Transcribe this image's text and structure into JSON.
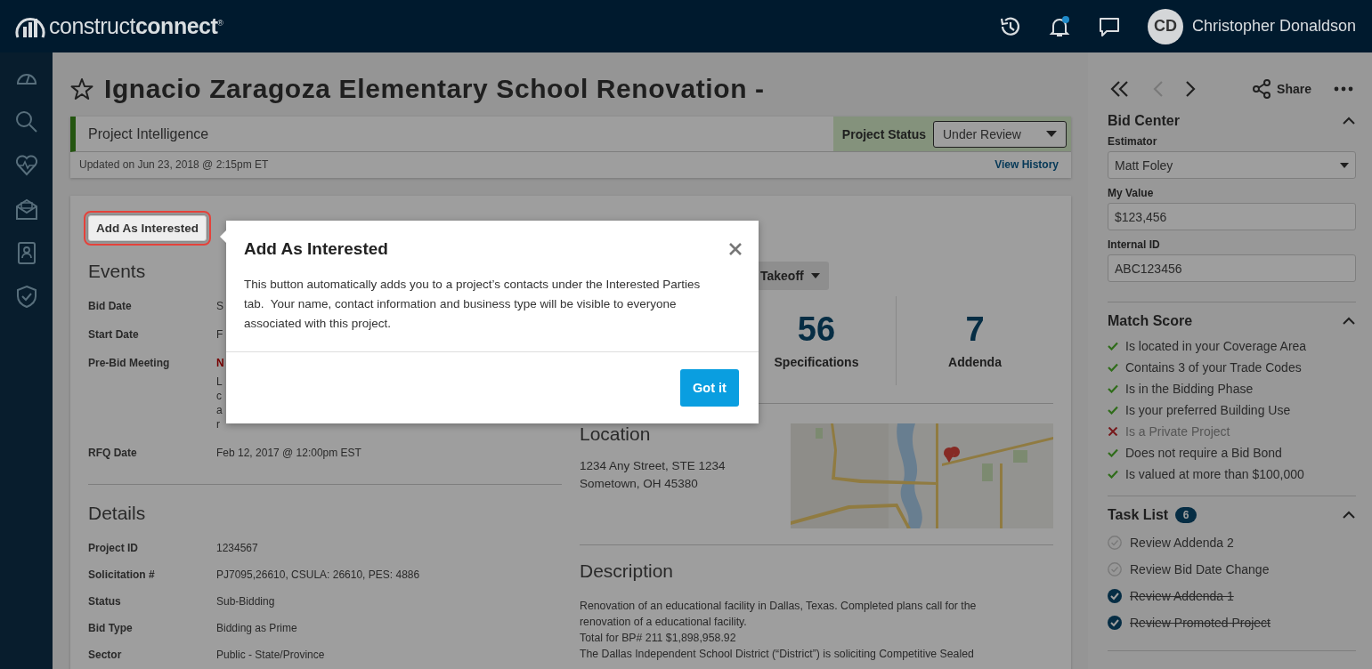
{
  "brand": {
    "logo_text": "construct**connect**$^{®}$"
  },
  "topbar": {
    "notifications_unread": true,
    "user": {
      "initials": "CD",
      "name": "Christopher Donaldson"
    }
  },
  "project": {
    "title": "Ignacio Zaragoza Elementary School Renovation -",
    "starred": false
  },
  "intelligence": {
    "label": "Project Intelligence",
    "status_label": "Project Status",
    "status_value": "Under Review",
    "updated": "Updated on Jun 23, 2018 @ 2:15pm ET",
    "history_link": "View History"
  },
  "card": {
    "interested_button": "Add As Interested",
    "events": {
      "heading": "Events",
      "rows": [
        {
          "label": "Bid Date",
          "value": "S",
          "alert": false
        },
        {
          "label": "Start Date",
          "value": "F",
          "alert": false
        },
        {
          "label": "Pre-Bid Meeting",
          "value": "N",
          "alert": true,
          "note_lines": [
            "L",
            "c",
            "a",
            "r"
          ]
        },
        {
          "label": "RFQ Date",
          "value": "Feb 12, 2017 @ 12:00pm EST",
          "alert": false
        }
      ]
    },
    "details": {
      "heading": "Details",
      "rows": [
        {
          "label": "Project ID",
          "value": "1234567"
        },
        {
          "label": "Solicitation #",
          "value": "PJ7095,26610, CSULA: 26610, PES: 4886"
        },
        {
          "label": "Status",
          "value": "Sub-Bidding"
        },
        {
          "label": "Bid Type",
          "value": "Bidding as Prime"
        },
        {
          "label": "Sector",
          "value": "Public - State/Province"
        }
      ]
    },
    "takeoff_button": "Takeoff",
    "stats": [
      {
        "value": "56",
        "label": "Specifications"
      },
      {
        "value": "7",
        "label": "Addenda"
      }
    ],
    "location": {
      "heading": "Location",
      "lines": [
        "1234 Any Street, STE 1234",
        "Sometown, OH 45380"
      ],
      "map": {
        "kind": "picture"
      }
    },
    "description": {
      "heading": "Description",
      "paragraphs": [
        "Renovation of an educational facility in Dallas, Texas. Completed plans call for the renovation of a educational facility.",
        "Total for BP# 211 $1,898,958.92",
        "The Dallas Independent School District (“District”) is soliciting Competitive Sealed"
      ]
    }
  },
  "right_panel": {
    "nav": {
      "previous_disabled": true,
      "share": "Share"
    },
    "bid_center": {
      "title": "Bid Center",
      "expanded": true,
      "fields": [
        {
          "label": "Estimator",
          "kind": "select",
          "value": "Matt Foley"
        },
        {
          "label": "My Value",
          "kind": "input",
          "value": "$123,456"
        },
        {
          "label": "Internal ID",
          "kind": "input",
          "value": "ABC123456"
        }
      ]
    },
    "match_score": {
      "title": "Match Score",
      "expanded": true,
      "items": [
        {
          "text": "Is located in your Coverage Area",
          "met": true
        },
        {
          "text": "Contains 3 of your Trade Codes",
          "met": true
        },
        {
          "text": "Is in the Bidding Phase",
          "met": true
        },
        {
          "text": "Is your preferred Building Use",
          "met": true
        },
        {
          "text": "Is a Private Project",
          "met": false
        },
        {
          "text": "Does not require a Bid Bond",
          "met": true
        },
        {
          "text": "Is valued at more than $100,000",
          "met": true
        }
      ]
    },
    "task_list": {
      "title": "Task List",
      "count": "6",
      "expanded": true,
      "tasks": [
        {
          "text": "Review Addenda 2",
          "done": false
        },
        {
          "text": "Review Bid Date Change",
          "done": false
        },
        {
          "text": "Review Addenda 1",
          "done": true
        },
        {
          "text": "Review Promoted Project",
          "done": true
        }
      ]
    }
  },
  "popover": {
    "title": "Add As Interested",
    "body": "This button automatically adds you to a project’s contacts under the Interested Parties tab.  Your name, contact information and business type will be visible to everyone associated with this project.",
    "button": "Got it"
  }
}
